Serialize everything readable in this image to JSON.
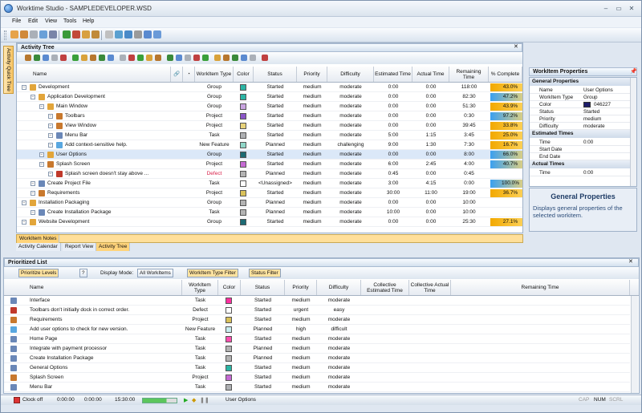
{
  "window": {
    "title": "Worktime Studio - SAMPLEDEVELOPER.WSD"
  },
  "menu": [
    "File",
    "Edit",
    "View",
    "Tools",
    "Help"
  ],
  "side_tab": "Activity Quick Tree",
  "activity_tree": {
    "title": "Activity Tree",
    "columns": [
      "Name",
      "WorkItem Type",
      "Color",
      "Status",
      "Priority",
      "Difficulty",
      "Estimated Time",
      "Actual Time",
      "Remaining Time",
      "% Complete"
    ],
    "rows": [
      {
        "name": "Development",
        "type": "Group",
        "color": "#2bb5a5",
        "status": "Started",
        "priority": "medium",
        "difficulty": "moderate",
        "est": "0:00",
        "act": "0:00",
        "rem": "118:00",
        "pct": "43.0%",
        "pct_color": "#f2a900",
        "indent": 0,
        "icon": "folder-icon"
      },
      {
        "name": "Application Development",
        "type": "Group",
        "color": "#2bb5a5",
        "status": "Started",
        "priority": "medium",
        "difficulty": "moderate",
        "est": "0:00",
        "act": "0:00",
        "rem": "82:30",
        "pct": "47.2%",
        "pct_color": "#3aa0f0",
        "indent": 1,
        "icon": "folder-icon"
      },
      {
        "name": "Main Window",
        "type": "Group",
        "color": "#c9a4e0",
        "status": "Started",
        "priority": "medium",
        "difficulty": "moderate",
        "est": "0:00",
        "act": "0:00",
        "rem": "51:30",
        "pct": "43.9%",
        "pct_color": "#f2a900",
        "indent": 2,
        "icon": "folder-icon"
      },
      {
        "name": "Toolbars",
        "type": "Project",
        "color": "#8a55c8",
        "status": "Started",
        "priority": "medium",
        "difficulty": "moderate",
        "est": "0:00",
        "act": "0:00",
        "rem": "0:30",
        "pct": "97.2%",
        "pct_color": "#3aa0f0",
        "indent": 3,
        "icon": "project-icon"
      },
      {
        "name": "View Window",
        "type": "Project",
        "color": "#e7d27a",
        "status": "Started",
        "priority": "medium",
        "difficulty": "moderate",
        "est": "0:00",
        "act": "0:00",
        "rem": "39:45",
        "pct": "33.8%",
        "pct_color": "#f2a900",
        "indent": 3,
        "icon": "project-icon"
      },
      {
        "name": "Menu Bar",
        "type": "Task",
        "color": "#aeb0b3",
        "status": "Started",
        "priority": "medium",
        "difficulty": "moderate",
        "est": "5:00",
        "act": "1:15",
        "rem": "3:45",
        "pct": "25.0%",
        "pct_color": "#f2a900",
        "indent": 3,
        "icon": "task-icon"
      },
      {
        "name": "Add context-sensitive help.",
        "type": "New Feature",
        "color": "#8fd6c8",
        "status": "Planned",
        "priority": "medium",
        "difficulty": "challenging",
        "est": "9:00",
        "act": "1:30",
        "rem": "7:30",
        "pct": "16.7%",
        "pct_color": "#f2a900",
        "indent": 3,
        "icon": "feature-icon"
      },
      {
        "name": "User Options",
        "type": "Group",
        "color": "#1c6a74",
        "status": "Started",
        "priority": "medium",
        "difficulty": "moderate",
        "est": "0:00",
        "act": "0:00",
        "rem": "8:00",
        "pct": "66.0%",
        "pct_color": "#3aa0f0",
        "indent": 2,
        "icon": "folder-icon",
        "selected": true
      },
      {
        "name": "Splash Screen",
        "type": "Project",
        "color": "#c56ad3",
        "status": "Started",
        "priority": "medium",
        "difficulty": "moderate",
        "est": "6:00",
        "act": "2:45",
        "rem": "4:00",
        "pct": "40.7%",
        "pct_color": "#3aa0f0",
        "indent": 2,
        "icon": "project-icon"
      },
      {
        "name": "Splash screen doesn't stay above ...",
        "type": "Defect",
        "color": "#b3b3b3",
        "status": "Planned",
        "priority": "medium",
        "difficulty": "moderate",
        "est": "0:45",
        "act": "0:00",
        "rem": "0:45",
        "pct": "",
        "pct_color": "",
        "indent": 3,
        "icon": "bug-icon",
        "type_color": "#d8204a"
      },
      {
        "name": "Create Project File",
        "type": "Task",
        "color": "#ffffff",
        "status": "<Unassigned>",
        "priority": "medium",
        "difficulty": "moderate",
        "est": "3:00",
        "act": "4:15",
        "rem": "0:00",
        "pct": "100.0%",
        "pct_color": "#3aa0f0",
        "indent": 1,
        "icon": "task-icon"
      },
      {
        "name": "Requirements",
        "type": "Project",
        "color": "#d9c15a",
        "status": "Started",
        "priority": "medium",
        "difficulty": "moderate",
        "est": "30:00",
        "act": "11:00",
        "rem": "19:00",
        "pct": "36.7%",
        "pct_color": "#f2a900",
        "indent": 1,
        "icon": "project-icon"
      },
      {
        "name": "Installation Packaging",
        "type": "Group",
        "color": "#b3b3b3",
        "status": "Planned",
        "priority": "medium",
        "difficulty": "moderate",
        "est": "0:00",
        "act": "0:00",
        "rem": "10:00",
        "pct": "",
        "pct_color": "",
        "indent": 0,
        "icon": "folder-icon"
      },
      {
        "name": "Create Installation Package",
        "type": "Task",
        "color": "#b3b3b3",
        "status": "Planned",
        "priority": "medium",
        "difficulty": "moderate",
        "est": "10:00",
        "act": "0:00",
        "rem": "10:00",
        "pct": "",
        "pct_color": "",
        "indent": 1,
        "icon": "task-icon"
      },
      {
        "name": "Website Development",
        "type": "Group",
        "color": "#1c6a74",
        "status": "Started",
        "priority": "medium",
        "difficulty": "moderate",
        "est": "0:00",
        "act": "0:00",
        "rem": "25:30",
        "pct": "27.1%",
        "pct_color": "#f2a900",
        "indent": 0,
        "icon": "folder-icon"
      }
    ]
  },
  "properties": {
    "title": "WorkItem Properties",
    "sections": [
      {
        "name": "General Properties",
        "items": [
          {
            "k": "Name",
            "v": "User Options"
          },
          {
            "k": "WorkItem Type",
            "v": "Group"
          },
          {
            "k": "Color",
            "v": "046227"
          },
          {
            "k": "Status",
            "v": "Started"
          },
          {
            "k": "Priority",
            "v": "medium"
          },
          {
            "k": "Difficulty",
            "v": "moderate"
          }
        ]
      },
      {
        "name": "Estimated Times",
        "items": [
          {
            "k": "Time",
            "v": "0:00"
          },
          {
            "k": "Start Date",
            "v": ""
          },
          {
            "k": "End Date",
            "v": ""
          }
        ]
      },
      {
        "name": "Actual Times",
        "items": [
          {
            "k": "Time",
            "v": "0:00"
          }
        ]
      }
    ],
    "help_title": "General Properties",
    "help_text": "Displays general properties of the selected workitem."
  },
  "notes_tab": "WorkItem Notes",
  "bottom_tabs": [
    "Activity Calendar",
    "Report View",
    "Activity Tree"
  ],
  "prioritized": {
    "title": "Prioritized List",
    "prioritize_btn": "Prioritize Levels",
    "display_mode_label": "Display Mode:",
    "display_mode_value": "All WorkItems",
    "type_filter": "WorkItem Type Filter",
    "status_filter": "Status Filter",
    "columns": [
      "Name",
      "WorkItem Type",
      "Color",
      "Status",
      "Priority",
      "Difficulty",
      "Collective Estimated Time",
      "Collective Actual Time",
      "Remaining Time"
    ],
    "rows": [
      {
        "name": "Interface",
        "type": "Task",
        "color": "#ff2fa0",
        "status": "Started",
        "priority": "medium",
        "difficulty": "moderate",
        "icon": "task-icon"
      },
      {
        "name": "Toolbars don't initially dock in correct order.",
        "type": "Defect",
        "color": "#ffffff",
        "status": "Started",
        "priority": "urgent",
        "difficulty": "easy",
        "icon": "bug-icon"
      },
      {
        "name": "Requirements",
        "type": "Project",
        "color": "#d9c15a",
        "status": "Started",
        "priority": "medium",
        "difficulty": "moderate",
        "icon": "project-icon"
      },
      {
        "name": "Add user options to check for new version.",
        "type": "New Feature",
        "color": "#c8ecee",
        "status": "Planned",
        "priority": "high",
        "difficulty": "difficult",
        "icon": "feature-icon"
      },
      {
        "name": "Home Page",
        "type": "Task",
        "color": "#ff4fb0",
        "status": "Started",
        "priority": "medium",
        "difficulty": "moderate",
        "icon": "task-icon"
      },
      {
        "name": "Integrate with payment processor",
        "type": "Task",
        "color": "#b3b3b3",
        "status": "Planned",
        "priority": "medium",
        "difficulty": "moderate",
        "icon": "task-icon"
      },
      {
        "name": "Create Installation Package",
        "type": "Task",
        "color": "#b3b3b3",
        "status": "Planned",
        "priority": "medium",
        "difficulty": "moderate",
        "icon": "task-icon"
      },
      {
        "name": "General Options",
        "type": "Task",
        "color": "#2bb5a5",
        "status": "Started",
        "priority": "medium",
        "difficulty": "moderate",
        "icon": "task-icon"
      },
      {
        "name": "Splash Screen",
        "type": "Project",
        "color": "#c56ad3",
        "status": "Started",
        "priority": "medium",
        "difficulty": "moderate",
        "icon": "project-icon"
      },
      {
        "name": "Menu Bar",
        "type": "Task",
        "color": "#aeb0b3",
        "status": "Started",
        "priority": "medium",
        "difficulty": "moderate",
        "icon": "task-icon"
      }
    ]
  },
  "status_bar": {
    "clock": "Clock off",
    "t1": "0:00:00",
    "t2": "0:00:00",
    "t3": "15:30:00",
    "current": "User Options",
    "caps": "CAP",
    "num": "NUM",
    "scrl": "SCRL"
  }
}
